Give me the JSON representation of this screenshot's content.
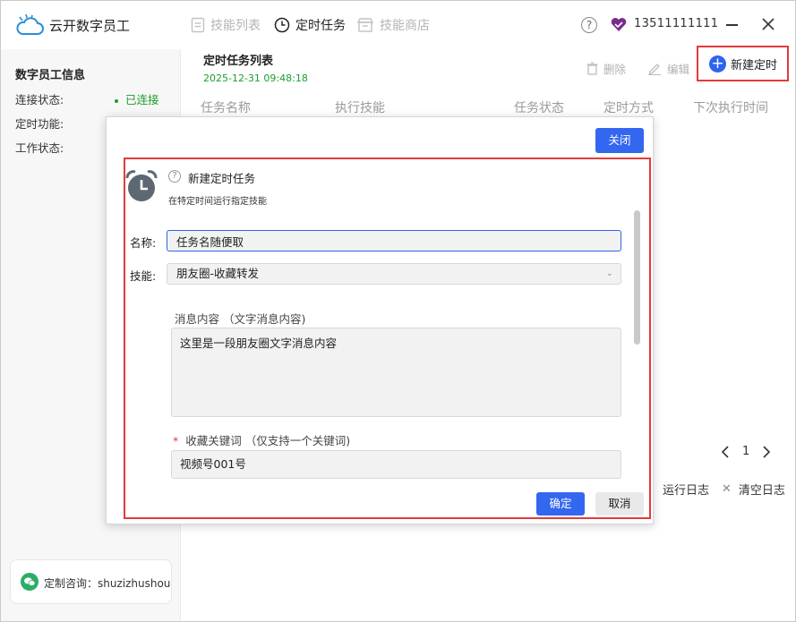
{
  "app": {
    "title": "云开数字员工"
  },
  "nav": {
    "tabs": [
      {
        "label": "技能列表",
        "icon": "doc-icon",
        "active": false
      },
      {
        "label": "定时任务",
        "icon": "clock-icon",
        "active": true
      },
      {
        "label": "技能商店",
        "icon": "store-icon",
        "active": false
      }
    ]
  },
  "user": {
    "phone": "13511111111",
    "help_glyph": "?"
  },
  "sidebar": {
    "title": "数字员工信息",
    "rows": [
      {
        "label": "连接状态:",
        "status": "已连接"
      },
      {
        "label": "定时功能:",
        "status": ""
      },
      {
        "label": "工作状态:",
        "status": ""
      }
    ],
    "contact": "定制咨询：shuzizhushou"
  },
  "main": {
    "title": "定时任务列表",
    "timestamp": "2025-12-31 09:48:18",
    "actions": {
      "delete": "删除",
      "edit": "编辑",
      "new": "新建定时"
    },
    "table": {
      "headers": [
        "任务名称",
        "执行技能",
        "任务状态",
        "定时方式",
        "下次执行时间"
      ]
    },
    "pagination": {
      "page": "1"
    },
    "logs": {
      "run_log": "运行日志",
      "clear_log": "清空日志"
    }
  },
  "modal": {
    "close_label": "关闭",
    "title": "新建定时任务",
    "subtitle": "在特定时间运行指定技能",
    "help_glyph": "?",
    "name_label": "名称:",
    "name_value": "任务名随便取",
    "skill_label": "技能:",
    "skill_value": "朋友圈-收藏转发",
    "message_label": "消息内容 （文字消息内容)",
    "message_value": "这里是一段朋友圈文字消息内容",
    "keyword_required": "*",
    "keyword_label": "收藏关键词 （仅支持一个关键词)",
    "keyword_value": "视频号001号",
    "ok_label": "确定",
    "cancel_label": "取消"
  },
  "colors": {
    "accent": "#3467f0",
    "highlight_border": "#e23b3b",
    "status_green": "#1a9e2c"
  }
}
